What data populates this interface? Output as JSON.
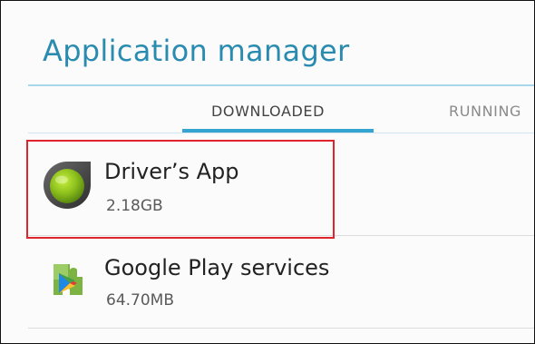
{
  "header": {
    "title": "Application manager"
  },
  "tabs": [
    {
      "label": "DOWNLOADED",
      "selected": true
    },
    {
      "label": "RUNNING"
    }
  ],
  "apps": [
    {
      "name": "Driver’s App",
      "size": "2.18GB",
      "icon": "driver-app-icon",
      "highlighted": true
    },
    {
      "name": "Google Play services",
      "size": "64.70MB",
      "icon": "google-play-services-icon"
    }
  ],
  "colors": {
    "title": "#2a8bb0",
    "tab_indicator": "#36a4d0",
    "highlight": "#e0242b"
  }
}
